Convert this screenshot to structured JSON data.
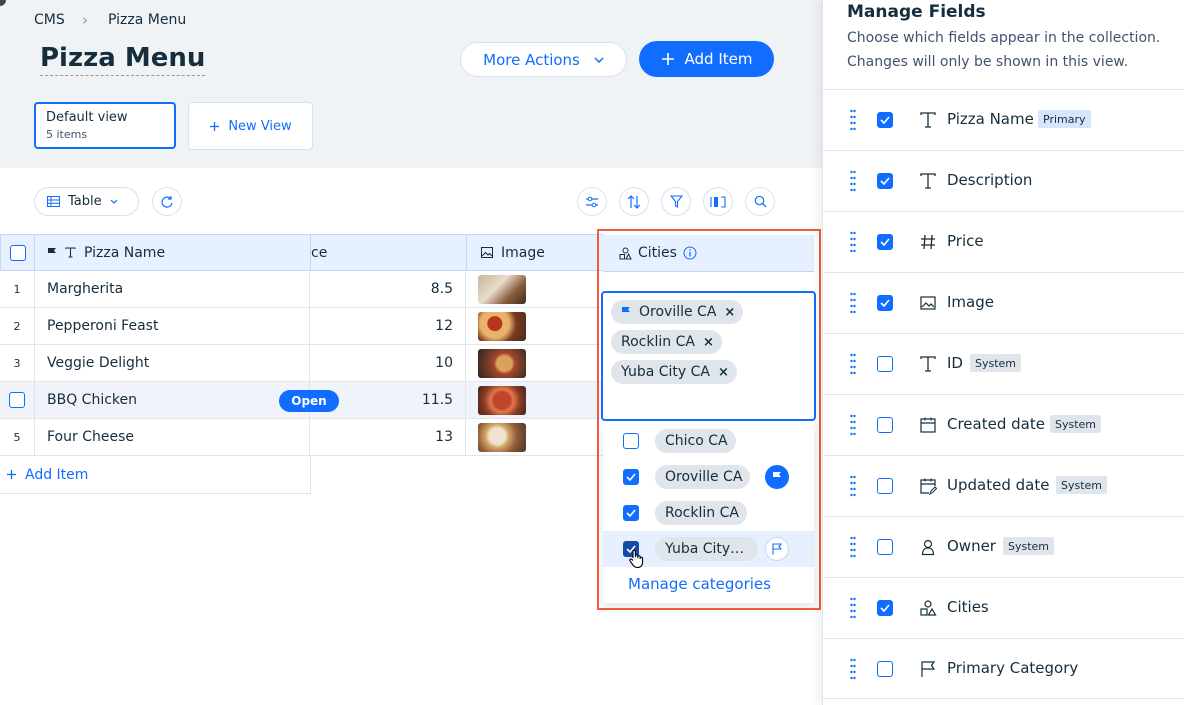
{
  "breadcrumb": {
    "root": "CMS",
    "separator": "›",
    "current": "Pizza Menu"
  },
  "header": {
    "title": "Pizza Menu",
    "more_actions": "More Actions",
    "add_item": "Add Item"
  },
  "views": {
    "default": {
      "name": "Default view",
      "count": "5 items"
    },
    "new_view": "New View"
  },
  "toolbar": {
    "layout": "Table",
    "icons": [
      "refresh-icon",
      "settings-sliders-icon",
      "sort-icon",
      "filter-icon",
      "columns-icon",
      "search-icon"
    ]
  },
  "table": {
    "columns": {
      "name": "Pizza Name",
      "price": "ce",
      "image": "Image",
      "cities": "Cities"
    },
    "rows": [
      {
        "num": "1",
        "name": "Margherita",
        "price": "8.5"
      },
      {
        "num": "2",
        "name": "Pepperoni Feast",
        "price": "12"
      },
      {
        "num": "3",
        "name": "Veggie Delight",
        "price": "10"
      },
      {
        "num": "4",
        "name": "BBQ Chicken",
        "price": "11.5",
        "open": "Open"
      },
      {
        "num": "5",
        "name": "Four Cheese",
        "price": "13"
      }
    ],
    "add_item": "Add Item"
  },
  "cities_editor": {
    "selected": [
      "Oroville CA",
      "Rocklin CA",
      "Yuba City CA"
    ],
    "remove_glyph": "×",
    "options": [
      {
        "label": "Chico CA",
        "checked": false
      },
      {
        "label": "Oroville CA",
        "checked": true,
        "primary": true
      },
      {
        "label": "Rocklin CA",
        "checked": true
      },
      {
        "label": "Yuba City…",
        "checked": true,
        "hovered": true
      }
    ],
    "manage": "Manage categories"
  },
  "manage_fields": {
    "title": "Manage Fields",
    "subtitle": "Choose which fields appear in the collection. Changes will only be shown in this view.",
    "fields": [
      {
        "label": "Pizza Name",
        "badge": "Primary",
        "checked": true,
        "icon": "text-icon"
      },
      {
        "label": "Description",
        "badge": "",
        "checked": true,
        "icon": "text-icon"
      },
      {
        "label": "Price",
        "badge": "",
        "checked": true,
        "icon": "hash-icon"
      },
      {
        "label": "Image",
        "badge": "",
        "checked": true,
        "icon": "image-icon"
      },
      {
        "label": "ID",
        "badge": "System",
        "checked": false,
        "icon": "text-icon"
      },
      {
        "label": "Created date",
        "badge": "System",
        "checked": false,
        "icon": "calendar-icon"
      },
      {
        "label": "Updated date",
        "badge": "System",
        "checked": false,
        "icon": "calendar-edit-icon"
      },
      {
        "label": "Owner",
        "badge": "System",
        "checked": false,
        "icon": "person-icon"
      },
      {
        "label": "Cities",
        "badge": "",
        "checked": true,
        "icon": "shapes-icon"
      },
      {
        "label": "Primary Category",
        "badge": "",
        "checked": false,
        "icon": "flag-icon"
      }
    ]
  },
  "colors": {
    "accent": "#116dff",
    "highlight": "#f05b41",
    "header_bg": "#f0f3f6"
  }
}
